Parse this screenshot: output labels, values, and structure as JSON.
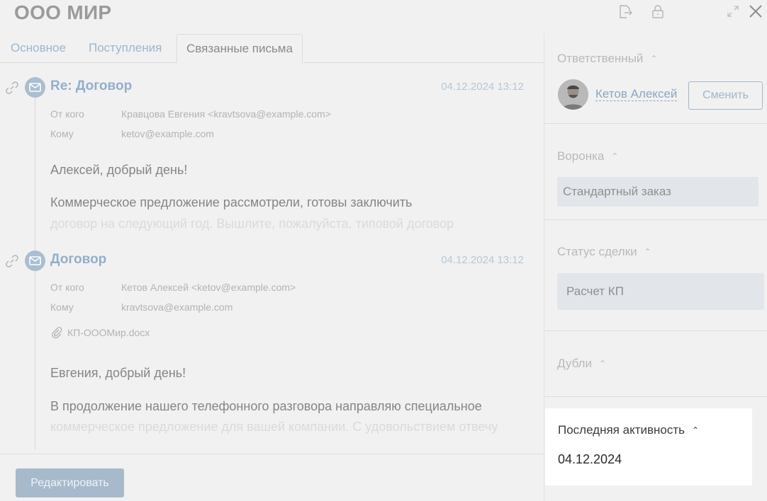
{
  "header": {
    "title": "ООО МИР"
  },
  "tabs": [
    {
      "label": "Основное"
    },
    {
      "label": "Поступления"
    },
    {
      "label": "Связанные письма"
    }
  ],
  "messages": [
    {
      "subject": "Re: Договор",
      "date": "04.12.2024 13:12",
      "from_label": "От кого",
      "from_value": "Кравцова Евгения <kravtsova@example.com>",
      "to_label": "Кому",
      "to_value": "ketov@example.com",
      "greeting": "Алексей, добрый день!",
      "line1": "Коммерческое предложение рассмотрели, готовы заключить",
      "line2": "договор на следующий год. Вышлите, пожалуйста, типовой договор"
    },
    {
      "subject": "Договор",
      "date": "04.12.2024 13:12",
      "from_label": "От кого",
      "from_value": "Кетов Алексей <ketov@example.com>",
      "to_label": "Кому",
      "to_value": "kravtsova@example.com",
      "attachment": "КП-ОООМир.docx",
      "greeting": "Евгения, добрый день!",
      "line1": "В продолжение нашего телефонного разговора направляю специальное",
      "line2": "коммерческое предложение для вашей компании. С удовольствием отвечу"
    }
  ],
  "footer": {
    "edit_label": "Редактировать"
  },
  "sidebar": {
    "responsible": {
      "title": "Ответственный",
      "owner": "Кетов Алексей",
      "change_label": "Сменить"
    },
    "funnel": {
      "title": "Воронка",
      "value": "Стандартный заказ"
    },
    "status": {
      "title": "Статус сделки",
      "value": "Расчет КП"
    },
    "duplicates": {
      "title": "Дубли"
    },
    "last_activity": {
      "title": "Последняя активность",
      "value": "04.12.2024"
    }
  },
  "colors": {
    "accent": "#93aecb",
    "button": "#a6bacb",
    "background": "#f1f1f1"
  },
  "icons": [
    "export-icon",
    "lock-icon",
    "expand-icon",
    "close-icon",
    "link-icon",
    "mail-icon",
    "paperclip-icon",
    "caret-up-icon"
  ]
}
